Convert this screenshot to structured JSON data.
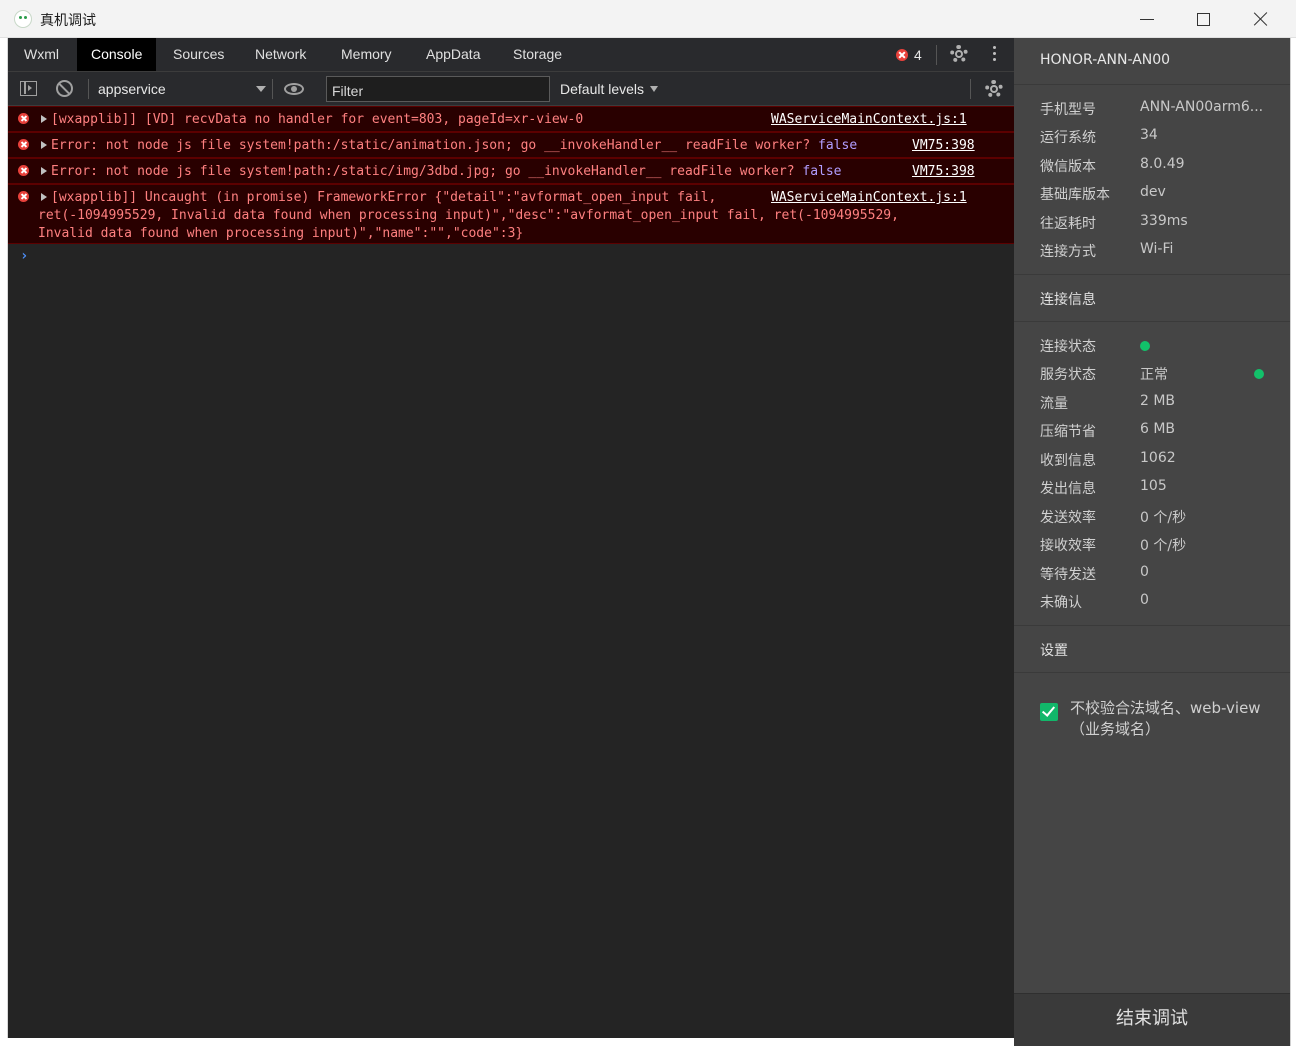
{
  "window": {
    "title": "真机调试"
  },
  "tabs": [
    {
      "label": "Wxml",
      "active": false
    },
    {
      "label": "Console",
      "active": true
    },
    {
      "label": "Sources",
      "active": false
    },
    {
      "label": "Network",
      "active": false
    },
    {
      "label": "Memory",
      "active": false
    },
    {
      "label": "AppData",
      "active": false
    },
    {
      "label": "Storage",
      "active": false
    }
  ],
  "error_count": "4",
  "toolbar": {
    "context": "appservice",
    "filter_placeholder": "Filter",
    "levels": "Default levels"
  },
  "messages": [
    {
      "text": "[wxapplib]] [VD] recvData no handler for event=803, pageId=xr-view-0",
      "source": "WAServiceMainContext.js:1"
    },
    {
      "text": "Error: not node js file system!path:/static/animation.json; go __invokeHandler__ readFile worker?",
      "keyword": "false",
      "source": "VM75:398"
    },
    {
      "text": "Error: not node js file system!path:/static/img/3dbd.jpg; go __invokeHandler__ readFile worker?",
      "keyword": "false",
      "source": "VM75:398"
    },
    {
      "text": "[wxapplib]] Uncaught (in promise) FrameworkError {\"detail\":\"avformat_open_input fail,",
      "line2": "ret(-1094995529, Invalid data found when processing input)\",\"desc\":\"avformat_open_input fail, ret(-1094995529,",
      "line3": "Invalid data found when processing input)\",\"name\":\"\",\"code\":3}",
      "source": "WAServiceMainContext.js:1"
    }
  ],
  "panel": {
    "device": "HONOR-ANN-AN00",
    "info": [
      {
        "label": "手机型号",
        "value": "ANN-AN00arm6..."
      },
      {
        "label": "运行系统",
        "value": "34"
      },
      {
        "label": "微信版本",
        "value": "8.0.49"
      },
      {
        "label": "基础库版本",
        "value": "dev"
      },
      {
        "label": "往返耗时",
        "value": "339ms"
      },
      {
        "label": "连接方式",
        "value": "Wi-Fi"
      }
    ],
    "conn_section": "连接信息",
    "conn": [
      {
        "label": "连接状态",
        "value": ""
      },
      {
        "label": "服务状态",
        "value": "正常"
      },
      {
        "label": "流量",
        "value": "2 MB"
      },
      {
        "label": "压缩节省",
        "value": "6 MB"
      },
      {
        "label": "收到信息",
        "value": "1062"
      },
      {
        "label": "发出信息",
        "value": "105"
      },
      {
        "label": "发送效率",
        "value": "0 个/秒"
      },
      {
        "label": "接收效率",
        "value": "0 个/秒"
      },
      {
        "label": "等待发送",
        "value": "0"
      },
      {
        "label": "未确认",
        "value": "0"
      }
    ],
    "settings_section": "设置",
    "checkbox_label": "不校验合法域名、web-view（业务域名）",
    "checkbox_checked": true,
    "end_button": "结束调试"
  },
  "colors": {
    "status_ok": "#12c16a",
    "error": "#e8413b"
  }
}
